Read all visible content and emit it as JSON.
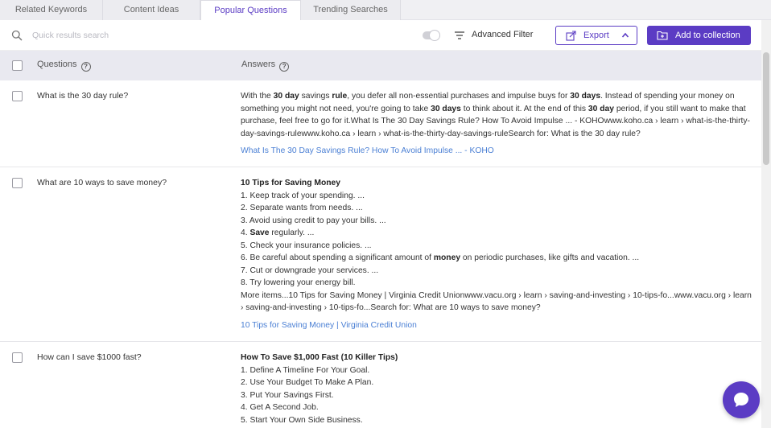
{
  "tabs": [
    "Related Keywords",
    "Content Ideas",
    "Popular Questions",
    "Trending Searches"
  ],
  "active_tab": 2,
  "toolbar": {
    "search_placeholder": "Quick results search",
    "advanced_filter": "Advanced Filter",
    "export": "Export",
    "add_to_collection": "Add to collection"
  },
  "table": {
    "col_questions": "Questions",
    "col_answers": "Answers",
    "help_glyph": "?"
  },
  "rows": [
    {
      "question": "What is the 30 day rule?",
      "answer_segments": [
        {
          "t": "With the "
        },
        {
          "t": "30 day",
          "b": true
        },
        {
          "t": " savings "
        },
        {
          "t": "rule",
          "b": true
        },
        {
          "t": ", you defer all non-essential purchases and impulse buys for "
        },
        {
          "t": "30 days",
          "b": true
        },
        {
          "t": ". Instead of spending your money on something you might not need, you're going to take "
        },
        {
          "t": "30 days",
          "b": true
        },
        {
          "t": " to think about it. At the end of this "
        },
        {
          "t": "30 day",
          "b": true
        },
        {
          "t": " period, if you still want to make that purchase, feel free to go for it.What Is The 30 Day Savings Rule? How To Avoid Impulse ... - KOHOwww.koho.ca › learn › what-is-the-thirty-day-savings-rulewww.koho.ca › learn › what-is-the-thirty-day-savings-ruleSearch for: What is the 30 day rule?"
        }
      ],
      "link": "What Is The 30 Day Savings Rule? How To Avoid Impulse ... - KOHO"
    },
    {
      "question": "What are 10 ways to save money?",
      "title": "10 Tips for Saving Money",
      "lines": [
        [
          {
            "t": "1. Keep track of your spending. ..."
          }
        ],
        [
          {
            "t": "2. Separate wants from needs. ..."
          }
        ],
        [
          {
            "t": "3. Avoid using credit to pay your bills. ..."
          }
        ],
        [
          {
            "t": "4. "
          },
          {
            "t": "Save",
            "b": true
          },
          {
            "t": " regularly. ..."
          }
        ],
        [
          {
            "t": "5. Check your insurance policies. ..."
          }
        ],
        [
          {
            "t": "6. Be careful about spending a significant amount of "
          },
          {
            "t": "money",
            "b": true
          },
          {
            "t": " on periodic purchases, like gifts and vacation. ..."
          }
        ],
        [
          {
            "t": "7. Cut or downgrade your services. ..."
          }
        ],
        [
          {
            "t": "8. Try lowering your energy bill."
          }
        ],
        [
          {
            "t": "More items...10 Tips for Saving Money | Virginia Credit Unionwww.vacu.org › learn › saving-and-investing › 10-tips-fo...www.vacu.org › learn › saving-and-investing › 10-tips-fo...Search for: What are 10 ways to save money?"
          }
        ]
      ],
      "link": "10 Tips for Saving Money | Virginia Credit Union"
    },
    {
      "question": "How can I save $1000 fast?",
      "title": "How To Save $1,000 Fast (10 Killer Tips)",
      "lines": [
        [
          {
            "t": "1. Define A Timeline For Your Goal."
          }
        ],
        [
          {
            "t": "2. Use Your Budget To Make A Plan."
          }
        ],
        [
          {
            "t": "3. Put Your Savings First."
          }
        ],
        [
          {
            "t": "4. Get A Second Job."
          }
        ],
        [
          {
            "t": "5. Start Your Own Side Business."
          }
        ]
      ]
    }
  ],
  "colors": {
    "accent": "#5b3cc4",
    "link": "#4a7fd4",
    "header_bg": "#e9e9f0"
  }
}
